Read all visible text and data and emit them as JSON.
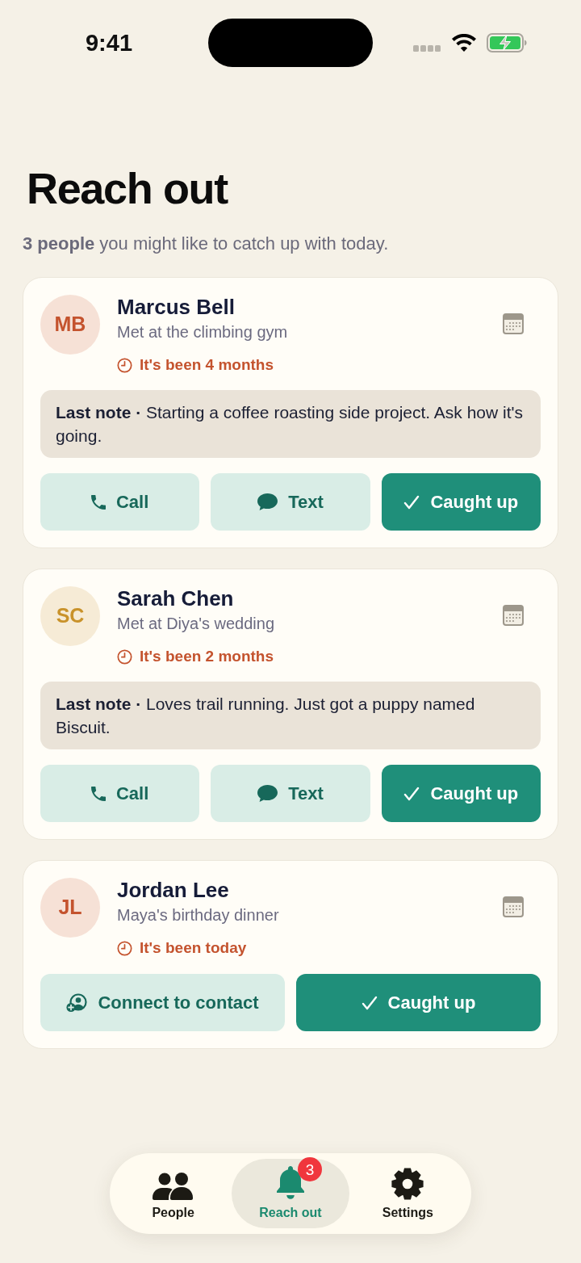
{
  "status_bar": {
    "time": "9:41"
  },
  "header": {
    "title": "Reach out",
    "subtitle": "**3 people** you might like to catch up with today."
  },
  "people": [
    {
      "initials": "MB",
      "color": "#c4532e",
      "name": "Marcus Bell",
      "context": "Met at the climbing gym",
      "last_contact": "It's been 4 months",
      "note": "**Last note ·** Starting a coffee roasting side project. Ask how it's going.",
      "actions": [
        {
          "kind": "call",
          "label": "Call"
        },
        {
          "kind": "text",
          "label": "Text"
        },
        {
          "kind": "caught_up",
          "label": "Caught up"
        }
      ]
    },
    {
      "initials": "SC",
      "color": "#c9922a",
      "name": "Sarah Chen",
      "context": "Met at Diya's wedding",
      "last_contact": "It's been 2 months",
      "note": "**Last note ·** Loves trail running. Just got a puppy named Biscuit.",
      "actions": [
        {
          "kind": "call",
          "label": "Call"
        },
        {
          "kind": "text",
          "label": "Text"
        },
        {
          "kind": "caught_up",
          "label": "Caught up"
        }
      ]
    },
    {
      "initials": "JL",
      "color": "#c4532e",
      "name": "Jordan Lee",
      "context": "Maya's birthday dinner",
      "last_contact": "It's been today",
      "actions": [
        {
          "kind": "connect",
          "label": "Connect to contact"
        },
        {
          "kind": "caught_up",
          "label": "Caught up"
        }
      ]
    }
  ],
  "tab_bar": [
    {
      "kind": "people",
      "label": "People",
      "selected": false
    },
    {
      "kind": "reach_out",
      "label": "Reach out",
      "selected": true,
      "badge": "3"
    },
    {
      "kind": "settings",
      "label": "Settings",
      "selected": false
    }
  ]
}
